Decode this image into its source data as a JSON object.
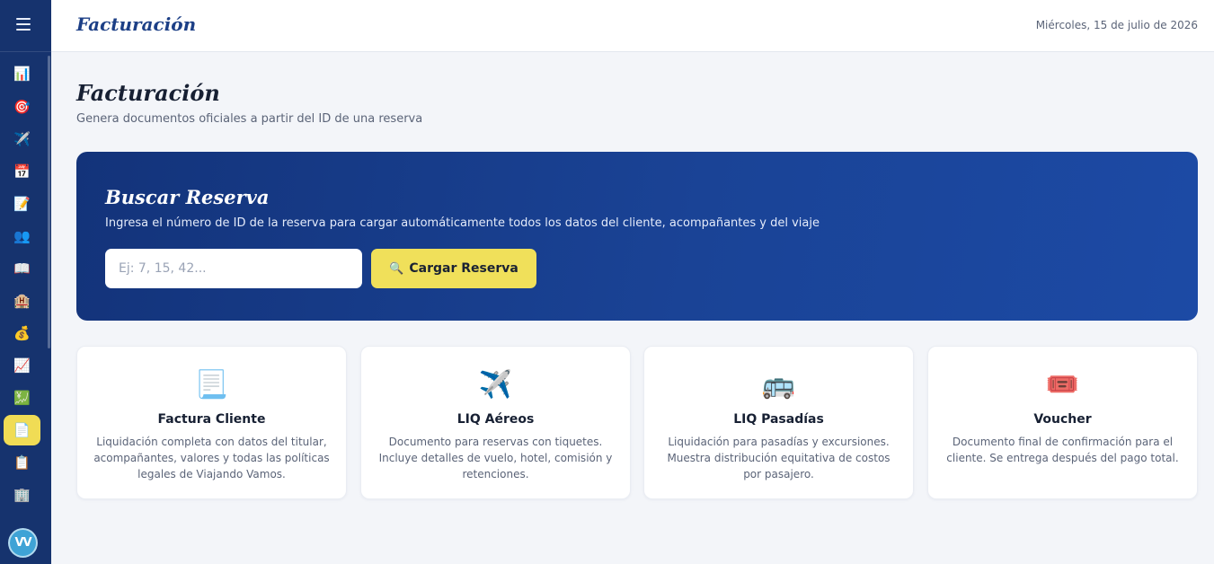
{
  "sidebar": {
    "menu_icon": "hamburger-menu-icon",
    "items": [
      {
        "icon": "📊",
        "name": "dashboard-icon"
      },
      {
        "icon": "🎯",
        "name": "target-icon"
      },
      {
        "icon": "✈️",
        "name": "airplane-icon"
      },
      {
        "icon": "📅",
        "name": "calendar-icon"
      },
      {
        "icon": "📝",
        "name": "memo-icon"
      },
      {
        "icon": "👥",
        "name": "users-icon"
      },
      {
        "icon": "📖",
        "name": "book-icon"
      },
      {
        "icon": "🏨",
        "name": "hotel-icon"
      },
      {
        "icon": "💰",
        "name": "money-bag-icon"
      },
      {
        "icon": "📈",
        "name": "chart-increasing-icon"
      },
      {
        "icon": "💹",
        "name": "finance-chart-icon"
      },
      {
        "icon": "📄",
        "name": "document-icon",
        "active": true
      },
      {
        "icon": "📋",
        "name": "clipboard-icon"
      },
      {
        "icon": "🏢",
        "name": "office-building-icon"
      }
    ],
    "avatar_initials": "VV"
  },
  "topbar": {
    "title": "Facturación",
    "date": "Miércoles, 15 de julio de 2026"
  },
  "page": {
    "title": "Facturación",
    "subtitle": "Genera documentos oficiales a partir del ID de una reserva"
  },
  "search": {
    "title": "Buscar Reserva",
    "description": "Ingresa el número de ID de la reserva para cargar automáticamente todos los datos del cliente, acompañantes y del viaje",
    "placeholder": "Ej: 7, 15, 42...",
    "value": "",
    "button_icon": "🔍",
    "button_label": "Cargar Reserva"
  },
  "cards": [
    {
      "icon": "📃",
      "title": "Factura Cliente",
      "description": "Liquidación completa con datos del titular, acompañantes, valores y todas las políticas legales de Viajando Vamos."
    },
    {
      "icon": "✈️",
      "title": "LIQ Aéreos",
      "description": "Documento para reservas con tiquetes. Incluye detalles de vuelo, hotel, comisión y retenciones."
    },
    {
      "icon": "🚌",
      "title": "LIQ Pasadías",
      "description": "Liquidación para pasadías y excursiones. Muestra distribución equitativa de costos por pasajero."
    },
    {
      "icon": "🎟️",
      "title": "Voucher",
      "description": "Documento final de confirmación para el cliente. Se entrega después del pago total."
    }
  ],
  "colors": {
    "sidebar": "#16336e",
    "accent": "#f0e05a",
    "banner_start": "#13337a",
    "banner_end": "#1c4aa5"
  }
}
